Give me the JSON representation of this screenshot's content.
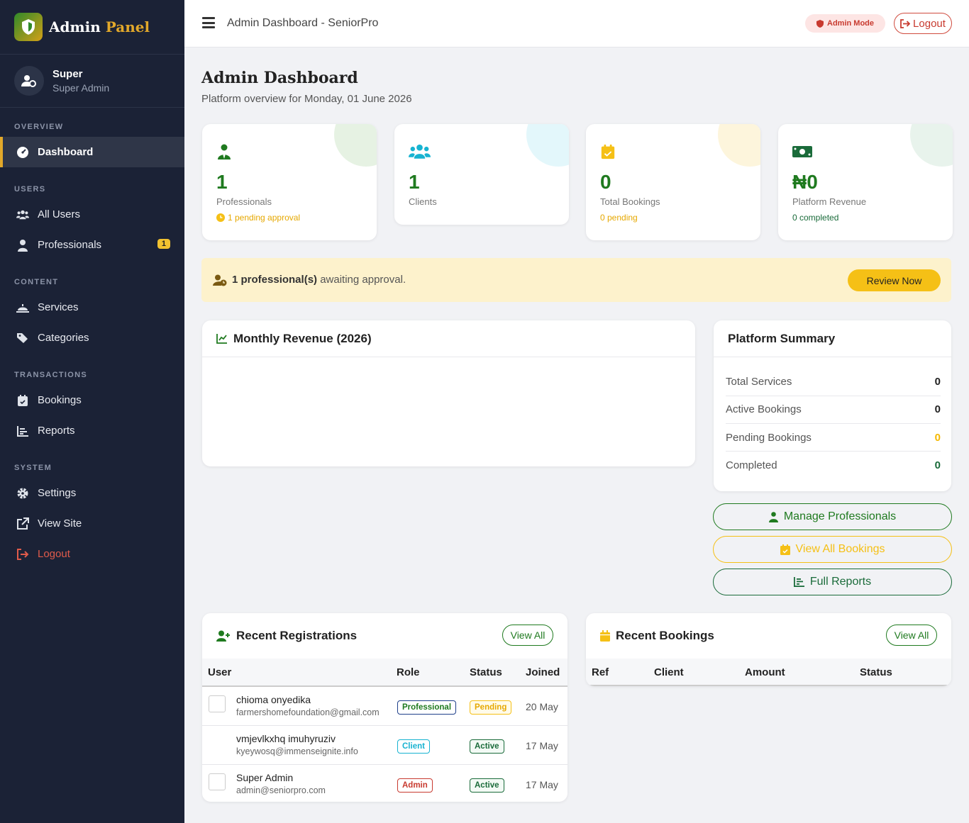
{
  "brand": {
    "word1": "Admin",
    "word2": "Panel"
  },
  "user": {
    "name": "Super",
    "role": "Super Admin"
  },
  "nav": {
    "sections": {
      "overview": "OVERVIEW",
      "users": "USERS",
      "content": "CONTENT",
      "transactions": "TRANSACTIONS",
      "system": "SYSTEM"
    },
    "dashboard": "Dashboard",
    "all_users": "All Users",
    "professionals": "Professionals",
    "professionals_badge": "1",
    "services": "Services",
    "categories": "Categories",
    "bookings": "Bookings",
    "reports": "Reports",
    "settings": "Settings",
    "view_site": "View Site",
    "logout": "Logout"
  },
  "topbar": {
    "title": "Admin Dashboard - SeniorPro",
    "admin_mode": "Admin Mode",
    "logout": "Logout"
  },
  "page": {
    "title": "Admin Dashboard",
    "subtitle": "Platform overview for Monday, 01 June 2026"
  },
  "stats": [
    {
      "value": "1",
      "label": "Professionals",
      "note": "1 pending approval",
      "color": "#1f7a1f"
    },
    {
      "value": "1",
      "label": "Clients",
      "note": "",
      "color": "#1f7a1f"
    },
    {
      "value": "0",
      "label": "Total Bookings",
      "note": "0 pending",
      "color": "#1f7a1f"
    },
    {
      "value": "₦0",
      "label": "Platform Revenue",
      "note": "0 completed",
      "color": "#1f7a1f"
    }
  ],
  "alert": {
    "bold": "1 professional(s)",
    "text": " awaiting approval.",
    "button": "Review Now"
  },
  "revenue": {
    "title": "Monthly Revenue (2026)"
  },
  "summary": {
    "title": "Platform Summary",
    "rows": [
      {
        "label": "Total Services",
        "value": "0"
      },
      {
        "label": "Active Bookings",
        "value": "0"
      },
      {
        "label": "Pending Bookings",
        "value": "0"
      },
      {
        "label": "Completed",
        "value": "0"
      }
    ]
  },
  "actions": {
    "manage": "Manage Professionals",
    "bookings": "View All Bookings",
    "reports": "Full Reports"
  },
  "registrations": {
    "title": "Recent Registrations",
    "view_all": "View All",
    "headers": {
      "user": "User",
      "role": "Role",
      "status": "Status",
      "joined": "Joined"
    },
    "rows": [
      {
        "name": "chioma onyedika",
        "email": "farmershomefoundation@gmail.com",
        "role": "Professional",
        "status": "Pending",
        "joined": "20 May"
      },
      {
        "name": "vmjevlkxhq imuhyruziv",
        "email": "kyeywosq@immenseignite.info",
        "role": "Client",
        "status": "Active",
        "joined": "17 May"
      },
      {
        "name": "Super Admin",
        "email": "admin@seniorpro.com",
        "role": "Admin",
        "status": "Active",
        "joined": "17 May"
      }
    ]
  },
  "bookings": {
    "title": "Recent Bookings",
    "view_all": "View All",
    "headers": {
      "ref": "Ref",
      "client": "Client",
      "amount": "Amount",
      "status": "Status"
    }
  },
  "colors": {
    "sidebar": "#1b2236",
    "accent": "#e2a82a",
    "green": "#1f7a1f",
    "yellow": "#f5c016",
    "cyan": "#17b3d1",
    "red": "#c83a2f"
  }
}
